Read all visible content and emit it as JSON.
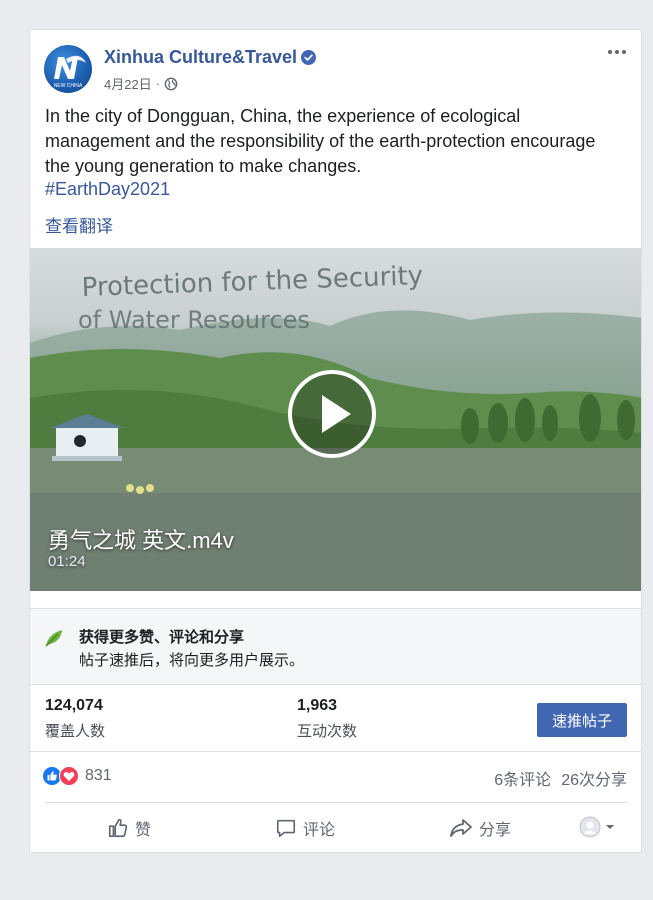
{
  "post": {
    "page_name": "Xinhua Culture&Travel",
    "verified_icon": "verified-badge-icon",
    "date": "4月22日",
    "separator": "·",
    "privacy_icon": "globe-icon",
    "avatar_text": "NEW CHINA",
    "text": "In the city of Dongguan, China, the experience of ecological management and the responsibility of the earth-protection encourage the young generation to make changes.",
    "hashtag": "#EarthDay2021",
    "translate_label": "查看翻译"
  },
  "video": {
    "overlay_line1": "Protection for the Security",
    "overlay_line2": "of Water Resources",
    "title": "勇气之城 英文.m4v",
    "duration": "01:24"
  },
  "boost": {
    "title": "获得更多赞、评论和分享",
    "description": "帖子速推后，将向更多用户展示。",
    "button_label": "速推帖子"
  },
  "stats": {
    "reach_value": "124,074",
    "reach_label": "覆盖人数",
    "engagement_value": "1,963",
    "engagement_label": "互动次数"
  },
  "reactions": {
    "count": "831",
    "comments": "6条评论",
    "shares": "26次分享"
  },
  "actions": {
    "like": "赞",
    "comment": "评论",
    "share": "分享"
  },
  "colors": {
    "link": "#385898",
    "button": "#4267b2",
    "like_blue": "#1877f2",
    "love_red": "#f33e58"
  }
}
